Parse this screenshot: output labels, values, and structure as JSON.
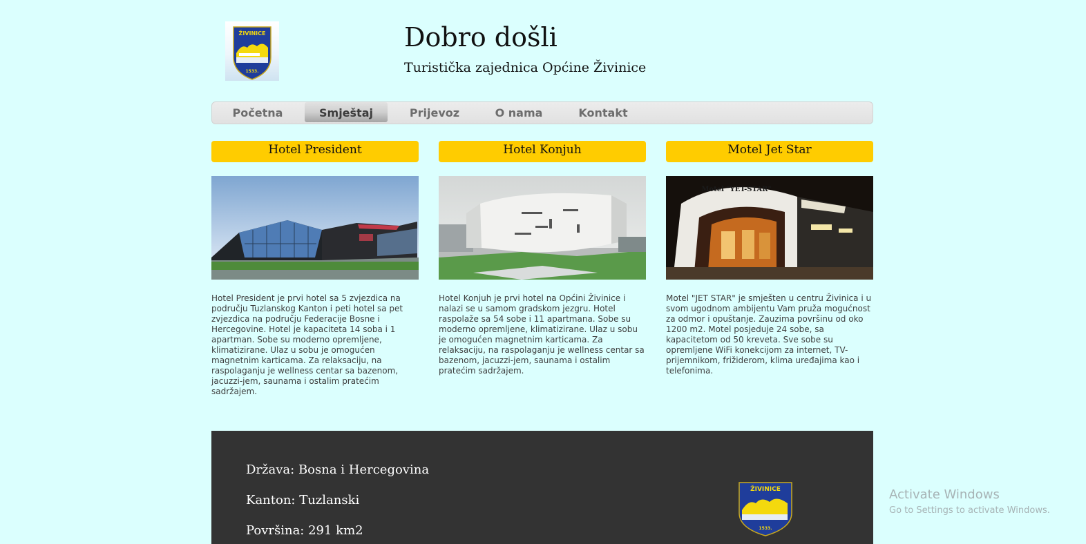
{
  "header": {
    "title": "Dobro došli",
    "subtitle": "Turistička zajednica Općine Živinice",
    "logo_text": "ŽIVINICE",
    "logo_year": "1533."
  },
  "nav": {
    "items": [
      {
        "label": "Početna",
        "active": false
      },
      {
        "label": "Smještaj",
        "active": true
      },
      {
        "label": "Prijevoz",
        "active": false
      },
      {
        "label": "O nama",
        "active": false
      },
      {
        "label": "Kontakt",
        "active": false
      }
    ]
  },
  "accommodations": [
    {
      "name": "Hotel President",
      "description": "Hotel President je prvi hotel sa 5 zvjezdica na području Tuzlanskog Kanton i peti hotel sa pet zvjezdica na području Federacije Bosne i Hercegovine. Hotel je kapaciteta 14 soba i 1 apartman. Sobe su moderno opremljene, klimatizirane. Ulaz u sobu je omogućen magnetnim karticama. Za relaksaciju, na raspolaganju je wellness centar sa bazenom, jacuzzi-jem, saunama i ostalim pratećim sadržajem."
    },
    {
      "name": "Hotel Konjuh",
      "description": "Hotel Konjuh je prvi hotel na Općini Živinice i nalazi se u samom gradskom jezgru. Hotel raspolaže sa 54 sobe i 11 apartmana. Sobe su moderno opremljene, klimatizirane. Ulaz u sobu je omogućen magnetnim karticama. Za relaksaciju, na raspolaganju je wellness centar sa bazenom, jacuzzi-jem, saunama i ostalim pratećim sadržajem."
    },
    {
      "name": "Motel Jet Star",
      "description": "Motel \"JET STAR\" je smješten u centru Živinica i u svom ugodnom ambijentu Vam pruža mogućnost za odmor i opuštanje. Zauzima površinu od oko 1200 m2. Motel posjeduje 24 sobe, sa kapacitetom od 50 kreveta. Sve sobe su opremljene WiFi konekcijom za internet, TV-prijemnikom, frižiderom, klima uređajima kao i telefonima.",
      "sign_text": "Motel \"YET-STAR\""
    }
  ],
  "footer": {
    "country": "Država: Bosna i Hercegovina",
    "canton": "Kanton: Tuzlanski",
    "area": "Površina: 291 km2"
  },
  "watermark": {
    "line1": "Activate Windows",
    "line2": "Go to Settings to activate Windows."
  },
  "colors": {
    "background": "#dbfffe",
    "accent": "#ffcc00",
    "footer": "#333333",
    "shield_blue": "#1f3d9b",
    "shield_yellow": "#f4d90e"
  }
}
